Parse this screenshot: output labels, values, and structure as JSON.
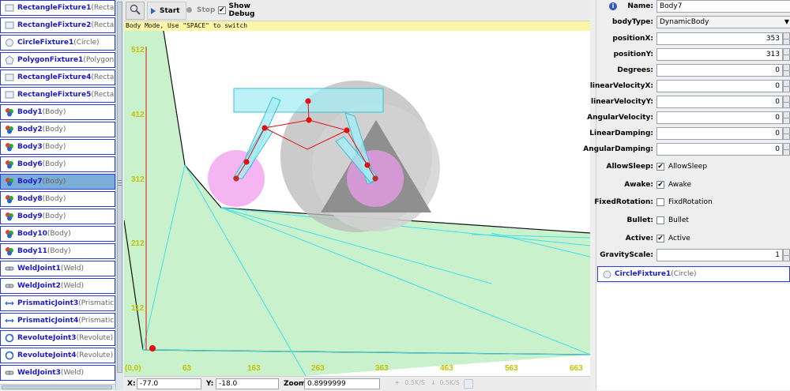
{
  "tree": {
    "items": [
      {
        "name": "RectangleFixture1",
        "type": "(Rectangle",
        "icon": "rectangle-fixture-icon",
        "selected": false
      },
      {
        "name": "RectangleFixture2",
        "type": "(Rectangle",
        "icon": "rectangle-fixture-icon",
        "selected": false
      },
      {
        "name": "CircleFixture1",
        "type": "(Circle)",
        "icon": "circle-fixture-icon",
        "selected": false
      },
      {
        "name": "PolygonFixture1",
        "type": "(Polygon)",
        "icon": "polygon-fixture-icon",
        "selected": false
      },
      {
        "name": "RectangleFixture4",
        "type": "(Rectangle",
        "icon": "rectangle-fixture-icon",
        "selected": false
      },
      {
        "name": "RectangleFixture5",
        "type": "(Rectangle",
        "icon": "rectangle-fixture-icon",
        "selected": false
      },
      {
        "name": "Body1",
        "type": "(Body)",
        "icon": "body-icon",
        "selected": false
      },
      {
        "name": "Body2",
        "type": "(Body)",
        "icon": "body-icon",
        "selected": false
      },
      {
        "name": "Body3",
        "type": "(Body)",
        "icon": "body-icon",
        "selected": false
      },
      {
        "name": "Body6",
        "type": "(Body)",
        "icon": "body-icon",
        "selected": false
      },
      {
        "name": "Body7",
        "type": "(Body)",
        "icon": "body-icon",
        "selected": true
      },
      {
        "name": "Body8",
        "type": "(Body)",
        "icon": "body-icon",
        "selected": false
      },
      {
        "name": "Body9",
        "type": "(Body)",
        "icon": "body-icon",
        "selected": false
      },
      {
        "name": "Body10",
        "type": "(Body)",
        "icon": "body-icon",
        "selected": false
      },
      {
        "name": "Body11",
        "type": "(Body)",
        "icon": "body-icon",
        "selected": false
      },
      {
        "name": "WeldJoint1",
        "type": "(Weld)",
        "icon": "weld-joint-icon",
        "selected": false
      },
      {
        "name": "WeldJoint2",
        "type": "(Weld)",
        "icon": "weld-joint-icon",
        "selected": false
      },
      {
        "name": "PrismaticJoint3",
        "type": "(Prismatic)",
        "icon": "prismatic-joint-icon",
        "selected": false
      },
      {
        "name": "PrismaticJoint4",
        "type": "(Prismatic)",
        "icon": "prismatic-joint-icon",
        "selected": false
      },
      {
        "name": "RevoluteJoint3",
        "type": "(Revolute)",
        "icon": "revolute-joint-icon",
        "selected": false
      },
      {
        "name": "RevoluteJoint4",
        "type": "(Revolute)",
        "icon": "revolute-joint-icon",
        "selected": false
      },
      {
        "name": "WeldJoint3",
        "type": "(Weld)",
        "icon": "weld-joint-icon",
        "selected": false
      }
    ]
  },
  "toolbar": {
    "start_label": "Start",
    "stop_label": "Stop",
    "debug_label": "Show Debug",
    "debug_checked": true
  },
  "canvas": {
    "mode_text": "Body Mode, Use  \"SPACE\"  to switch",
    "origin_label": "(0,0)",
    "y_ticks": [
      "512",
      "412",
      "312",
      "212",
      "112"
    ],
    "x_ticks": [
      "63",
      "163",
      "263",
      "363",
      "463",
      "563",
      "663"
    ],
    "colors": {
      "ground_fill": "#c9f2cc",
      "edge_cyan": "#3ee0ea",
      "gray_wheel": "#b9b9b9",
      "pink_wheel": "#f2a8f0",
      "joint_red": "#e01010",
      "axis_tick_text": "#c6c200"
    }
  },
  "status": {
    "x_label": "X:",
    "x_value": "-77.0",
    "y_label": "Y:",
    "y_value": "-18.0",
    "zoom_label": "Zoom:",
    "zoom_value": "0.8999999",
    "rate1": "0.5K/S",
    "rate2": "0.5K/S"
  },
  "props": {
    "name_label": "Name:",
    "name_value": "Body7",
    "bodytype_label": "bodyType:",
    "bodytype_value": "DynamicBody",
    "rows": [
      {
        "label": "positionX:",
        "value": "353"
      },
      {
        "label": "positionY:",
        "value": "313"
      },
      {
        "label": "Degrees:",
        "value": "0"
      },
      {
        "label": "linearVelocityX:",
        "value": "0"
      },
      {
        "label": "linearVelocityY:",
        "value": "0"
      },
      {
        "label": "AngularVelocity:",
        "value": "0"
      },
      {
        "label": "LinearDamping:",
        "value": "0"
      },
      {
        "label": "AngularDamping:",
        "value": "0"
      }
    ],
    "checks": [
      {
        "label": "AllowSleep:",
        "text": "AllowSleep",
        "checked": true
      },
      {
        "label": "Awake:",
        "text": "Awake",
        "checked": true
      },
      {
        "label": "FixedRotation:",
        "text": "FixdRotation",
        "checked": false
      },
      {
        "label": "Bullet:",
        "text": "Bullet",
        "checked": false
      },
      {
        "label": "Active:",
        "text": "Active",
        "checked": true
      }
    ],
    "gravity_label": "GravityScale:",
    "gravity_value": "1",
    "fixture_name": "CircleFixture1",
    "fixture_type": "(Circle)"
  }
}
